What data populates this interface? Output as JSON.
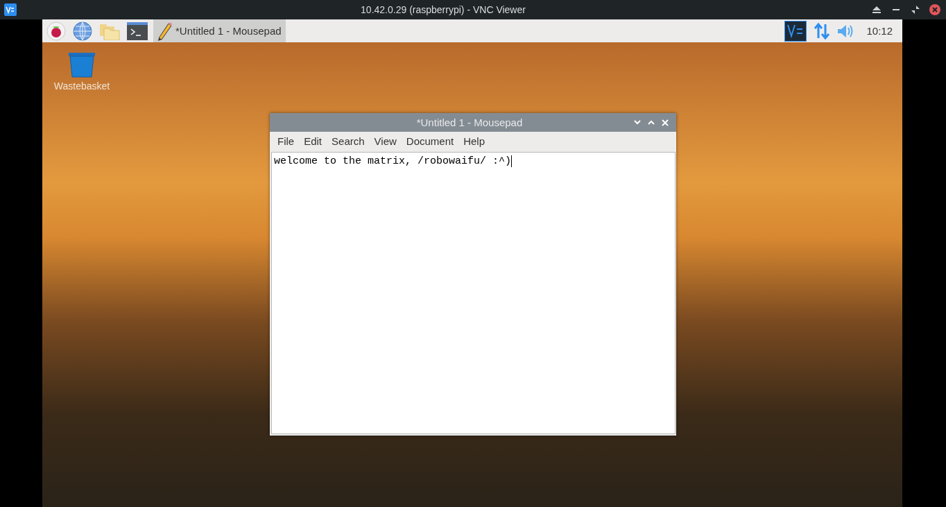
{
  "viewer": {
    "title": "10.42.0.29 (raspberrypi) - VNC Viewer"
  },
  "taskbar": {
    "task": {
      "label": "*Untitled 1 - Mousepad",
      "selected": true
    },
    "clock": "10:12"
  },
  "desktop_icons": [
    {
      "label": "Wastebasket"
    }
  ],
  "editor": {
    "title": "*Untitled 1 - Mousepad",
    "menu": [
      "File",
      "Edit",
      "Search",
      "View",
      "Document",
      "Help"
    ],
    "text": "welcome to the matrix, /robowaifu/ :^)"
  }
}
